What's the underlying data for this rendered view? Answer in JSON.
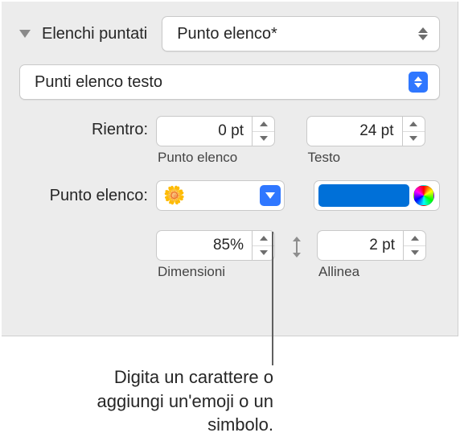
{
  "section": {
    "title": "Elenchi puntati"
  },
  "style_popup": {
    "label": "Punto elenco*"
  },
  "type_popup": {
    "label": "Punti elenco testo"
  },
  "indent": {
    "label": "Rientro:",
    "bullet": {
      "value": "0 pt",
      "caption": "Punto elenco"
    },
    "text": {
      "value": "24 pt",
      "caption": "Testo"
    }
  },
  "bullet": {
    "label": "Punto elenco:",
    "emoji": "🌼",
    "color": "#0070d8"
  },
  "size": {
    "value": "85%",
    "caption": "Dimensioni"
  },
  "align": {
    "value": "2 pt",
    "caption": "Allinea"
  },
  "callout": "Digita un carattere o aggiungi un'emoji o un simbolo."
}
